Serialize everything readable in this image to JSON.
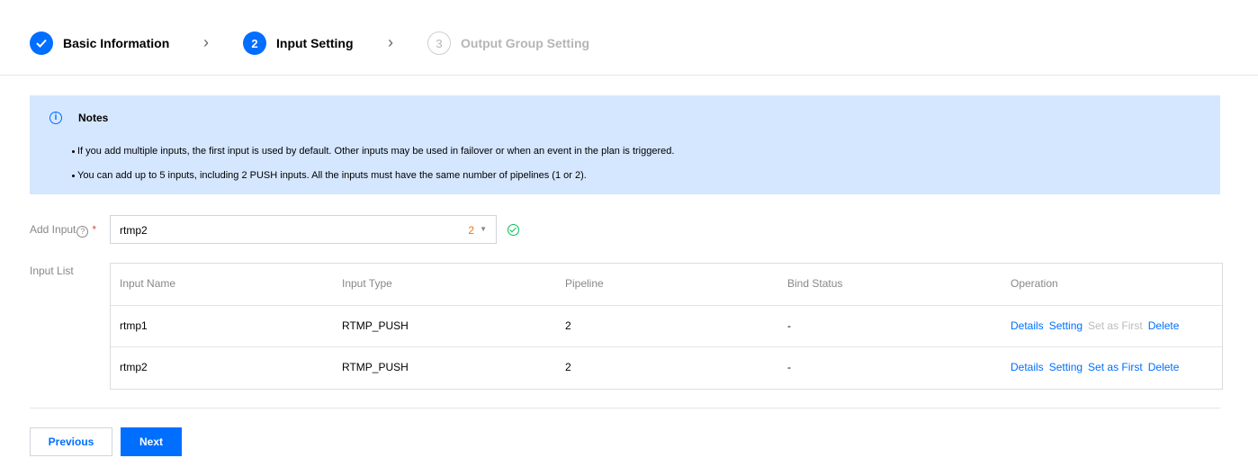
{
  "steps": [
    {
      "number": "",
      "label": "Basic Information",
      "state": "done"
    },
    {
      "number": "2",
      "label": "Input Setting",
      "state": "active"
    },
    {
      "number": "3",
      "label": "Output Group Setting",
      "state": "pending"
    }
  ],
  "step_separator": "›",
  "notes": {
    "title": "Notes",
    "icon": "info-icon",
    "items": [
      "If you add multiple inputs, the first input is used by default. Other inputs may be used in failover or when an event in the plan is triggered.",
      "You can add up to 5 inputs, including 2 PUSH inputs. All the inputs must have the same number of pipelines (1 or 2)."
    ]
  },
  "add_input": {
    "label": "Add Input",
    "help_icon": "?",
    "required_mark": "*",
    "value": "rtmp2",
    "count": "2",
    "caret": "▼",
    "status_icon": "check-circle-icon"
  },
  "input_list": {
    "label": "Input List",
    "columns": [
      "Input Name",
      "Input Type",
      "Pipeline",
      "Bind Status",
      "Operation"
    ],
    "rows": [
      {
        "name": "rtmp1",
        "type": "RTMP_PUSH",
        "pipeline": "2",
        "bind_status": "-",
        "operations": {
          "details": "Details",
          "setting": "Setting",
          "set_first": "Set as First",
          "delete": "Delete"
        },
        "set_first_enabled": false
      },
      {
        "name": "rtmp2",
        "type": "RTMP_PUSH",
        "pipeline": "2",
        "bind_status": "-",
        "operations": {
          "details": "Details",
          "setting": "Setting",
          "set_first": "Set as First",
          "delete": "Delete"
        },
        "set_first_enabled": true
      }
    ]
  },
  "buttons": {
    "previous": "Previous",
    "next": "Next"
  },
  "colors": {
    "accent": "#006eff",
    "notes_bg": "#d5e7ff",
    "success": "#0abf5b",
    "count": "#ff7200",
    "required": "#e54545"
  }
}
